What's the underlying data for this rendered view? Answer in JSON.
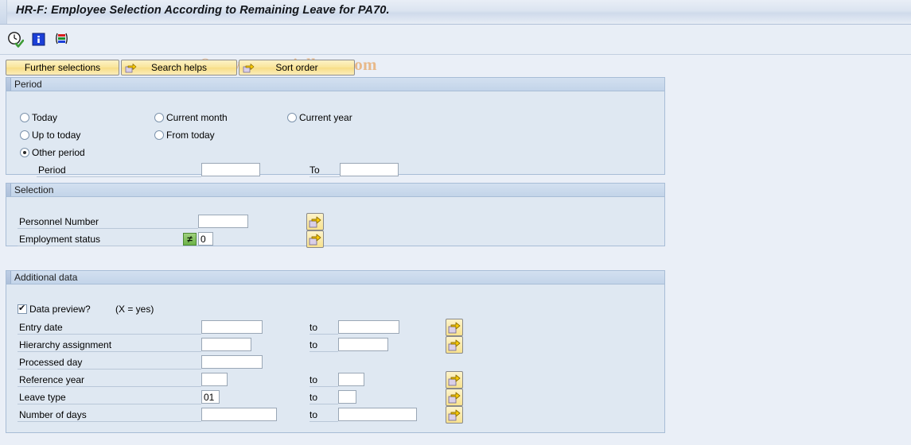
{
  "window": {
    "title": "HR-F: Employee Selection According to Remaining Leave for PA70."
  },
  "watermark": {
    "text": "© www.tutorialkart.com"
  },
  "toolbar": {
    "icons": [
      {
        "name": "execute-clock-icon",
        "title": "Execute"
      },
      {
        "name": "info-icon",
        "title": "Information"
      },
      {
        "name": "selection-variant-icon",
        "title": "Selection options"
      }
    ]
  },
  "action_buttons": [
    {
      "label": "Further selections",
      "icon": "none"
    },
    {
      "label": "Search helps",
      "icon": "yellow-arrow-icon"
    },
    {
      "label": "Sort order",
      "icon": "yellow-arrow-icon"
    }
  ],
  "period_section": {
    "title": "Period",
    "radios": [
      {
        "label": "Today",
        "selected": false
      },
      {
        "label": "Current month",
        "selected": false
      },
      {
        "label": "Current year",
        "selected": false
      },
      {
        "label": "Up to today",
        "selected": false
      },
      {
        "label": "From today",
        "selected": false
      },
      {
        "label": "Other period",
        "selected": true
      }
    ],
    "period_label": "Period",
    "period_value": "",
    "to_label": "To",
    "to_value": ""
  },
  "selection_section": {
    "title": "Selection",
    "rows": [
      {
        "label": "Personnel Number",
        "value": "",
        "operator": "",
        "has_multiselect": true
      },
      {
        "label": "Employment status",
        "value": "0",
        "operator": "≠",
        "has_multiselect": true
      }
    ]
  },
  "additional_section": {
    "title": "Additional data",
    "checkbox": {
      "label": "Data preview?",
      "checked": true
    },
    "checkbox_hint": "(X = yes)",
    "to_label": "to",
    "rows": [
      {
        "label": "Entry date",
        "from": "",
        "to": "",
        "has_to": true,
        "has_multiselect": true
      },
      {
        "label": "Hierarchy assignment",
        "from": "",
        "to": "",
        "has_to": true,
        "has_multiselect": true
      },
      {
        "label": "Processed day",
        "from": "",
        "to": "",
        "has_to": false,
        "has_multiselect": false
      },
      {
        "label": "Reference year",
        "from": "",
        "to": "",
        "has_to": true,
        "has_multiselect": true
      },
      {
        "label": "Leave type",
        "from": "01",
        "to": "",
        "has_to": true,
        "has_multiselect": true
      },
      {
        "label": "Number of days",
        "from": "",
        "to": "",
        "has_to": true,
        "has_multiselect": true
      }
    ]
  },
  "colors": {
    "page_background": "#eaeff7",
    "panel_background": "#dfe8f2",
    "panel_border": "#a8bdd6",
    "button_yellow": "#f9e59a",
    "accent_green": "#6cb347",
    "watermark": "#e8b98a"
  }
}
